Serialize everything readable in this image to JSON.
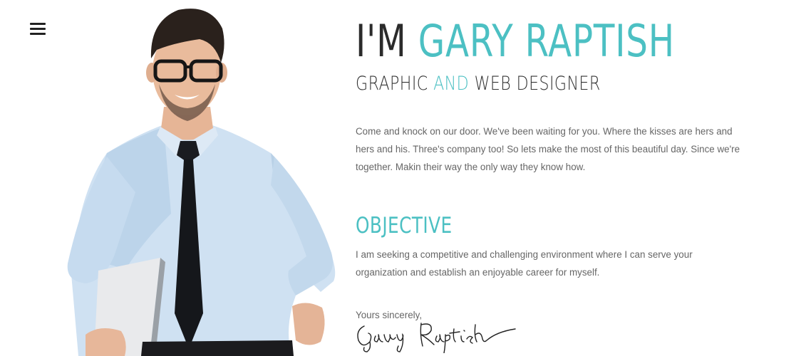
{
  "menu": {
    "icon": "hamburger-icon"
  },
  "hero": {
    "prefix": "I'M",
    "name": "GARY RAPTISH",
    "accent_color": "#4cc0c3"
  },
  "subtitle": {
    "part1": "GRAPHIC",
    "accent": "AND",
    "part2": "WEB DESIGNER"
  },
  "intro": "Come and knock on our door. We've been waiting for you. Where the kisses are hers and hers and his. Three's company too! So lets make the most of this beautiful day. Since we're together. Makin their way the only way they know how.",
  "objective": {
    "title": "OBJECTIVE",
    "text": "I am seeking a competitive and challenging environment where I can serve your organization and establish an enjoyable career for myself."
  },
  "closing": "Yours sincerely,",
  "signature": "Gary Raptish"
}
